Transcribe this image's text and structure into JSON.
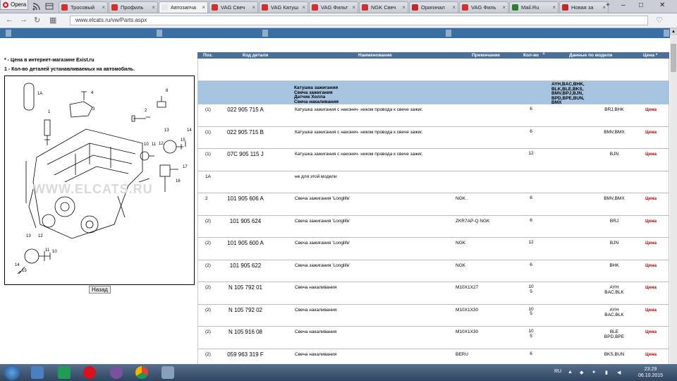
{
  "browser": {
    "opera_label": "Opera",
    "tabs": [
      {
        "label": "Тросовый",
        "color": "#d32f2f"
      },
      {
        "label": "Профиль",
        "color": "#d32f2f"
      },
      {
        "label": "Автозапча",
        "color": "#e8e8e8",
        "active": true
      },
      {
        "label": "VAG Свеч",
        "color": "#d32f2f"
      },
      {
        "label": "VAG Катуш",
        "color": "#d32f2f"
      },
      {
        "label": "VAG Фильт",
        "color": "#d32f2f"
      },
      {
        "label": "NGK Свеч",
        "color": "#d32f2f"
      },
      {
        "label": "Оригинал",
        "color": "#c62828"
      },
      {
        "label": "VAG Филь",
        "color": "#d32f2f"
      },
      {
        "label": "Mail.Ru",
        "color": "#2e7d32"
      },
      {
        "label": "Новая за",
        "color": "#c62828"
      }
    ],
    "url": "www.elcats.ru/vw/Parts.aspx"
  },
  "notes": {
    "price_note": "* - Цена в интернет-магазине Exist.ru",
    "qty_note": "1 - Кол-во деталей устанавливаемых на автомобиль."
  },
  "diagram": {
    "watermark": "WWW.ELCATS.RU",
    "callouts": [
      "1A",
      "1",
      "4",
      "3",
      "8",
      "2",
      "13",
      "14",
      "15",
      "12",
      "11",
      "10",
      "17",
      "16",
      "13",
      "12",
      "11",
      "10",
      "14",
      "15"
    ]
  },
  "back_button": "Назад",
  "table": {
    "headers": {
      "pos": "Поз.",
      "code": "Код детали",
      "name": "Наименование",
      "note": "Примечание",
      "qty": "Кол-во",
      "qty_sup": "1",
      "model": "Данные по модели",
      "price": "Цена *"
    },
    "group": {
      "names": [
        "Катушка зажигания",
        "Свеча зажигания",
        "Датчик Холла",
        "Свеча накаливания"
      ],
      "models": [
        "AYH,BAC,BHK,",
        "BLK,BLE,BKS,",
        "BMV,BPJ,BJN,",
        "BPD,BPE,BUN,",
        "BMX"
      ]
    },
    "rows": [
      {
        "pos": "(1)",
        "code": "022 905 715 A",
        "name": "Катушка зажигания с наконеч- ником провода к свече зажиг.",
        "note": "",
        "qty": [
          "6"
        ],
        "model": [
          "BRJ,BHK"
        ],
        "price": "Цена"
      },
      {
        "pos": "(1)",
        "code": "022 905 715 B",
        "name": "Катушка зажигания с наконеч- ником провода к свече зажиг.",
        "note": "",
        "qty": [
          "6"
        ],
        "model": [
          "BMV,BMX"
        ],
        "price": "Цена"
      },
      {
        "pos": "(1)",
        "code": "07C 905 115 J",
        "name": "Катушка зажигания с наконеч- ником провода к свече зажиг.",
        "note": "",
        "qty": [
          "12"
        ],
        "model": [
          "BJN"
        ],
        "price": "Цена"
      },
      {
        "pos": "1A",
        "code": "",
        "name": "не для этой модели",
        "note": "",
        "qty": [
          ""
        ],
        "model": [
          ""
        ],
        "price": ""
      },
      {
        "pos": "2",
        "code": "101 905 606 A",
        "name": "Свеча зажигания 'Longlife'",
        "note": "NGK",
        "qty": [
          "6"
        ],
        "model": [
          "BMV,BMX"
        ],
        "price": "Цена"
      },
      {
        "pos": "(2)",
        "code": "101 905 624",
        "name": "Свеча зажигания 'Longlife'",
        "note": "ZKR7AP-Q NGK",
        "qty": [
          "6"
        ],
        "model": [
          "BRJ"
        ],
        "price": "Цена"
      },
      {
        "pos": "(2)",
        "code": "101 905 600 A",
        "name": "Свеча зажигания 'Longlife'",
        "note": "NGK",
        "qty": [
          "12"
        ],
        "model": [
          "BJN"
        ],
        "price": "Цена"
      },
      {
        "pos": "(2)",
        "code": "101 905 622",
        "name": "Свеча зажигания 'Longlife'",
        "note": "NGK",
        "qty": [
          "6"
        ],
        "model": [
          "BHK"
        ],
        "price": "Цена"
      },
      {
        "pos": "(2)",
        "code": "N 105 792 01",
        "name": "Свеча накаливания",
        "note": "M10X1X27",
        "qty": [
          "10",
          "5"
        ],
        "model": [
          "AYH",
          "BAC,BLK"
        ],
        "price": "Цена"
      },
      {
        "pos": "(2)",
        "code": "N 105 792 02",
        "name": "Свеча накаливания",
        "note": "M10X1X30",
        "qty": [
          "10",
          "5"
        ],
        "model": [
          "AYH",
          "BAC,BLK"
        ],
        "price": "Цена"
      },
      {
        "pos": "(2)",
        "code": "N 105 916 08",
        "name": "Свеча накаливания",
        "note": "M10X1X30",
        "qty": [
          "10",
          "5"
        ],
        "model": [
          "BLE",
          "BPD,BPE"
        ],
        "price": "Цена"
      },
      {
        "pos": "(2)",
        "code": "059 963 319 F",
        "name": "Свеча накаливания",
        "note": "BERU",
        "qty": [
          "6"
        ],
        "model": [
          "BKS,BUN"
        ],
        "price": "Цена"
      }
    ]
  },
  "taskbar": {
    "language": "RU",
    "time": "23:29",
    "date": "06.10.2015"
  }
}
